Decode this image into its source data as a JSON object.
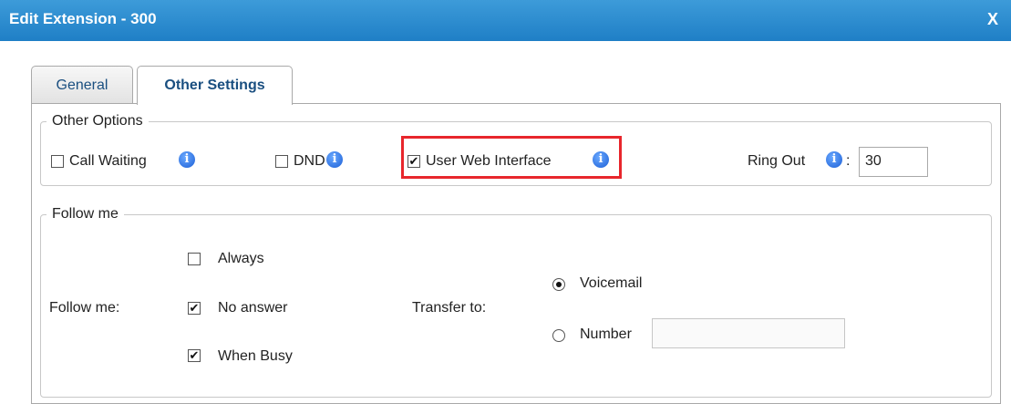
{
  "dialog": {
    "title": "Edit Extension - 300",
    "close_label": "X"
  },
  "tabs": [
    {
      "label": "General",
      "active": false
    },
    {
      "label": "Other Settings",
      "active": true
    }
  ],
  "other_options": {
    "legend": "Other Options",
    "call_waiting": {
      "label": "Call Waiting",
      "checked": false,
      "info_icon": "info-icon"
    },
    "dnd": {
      "label": "DND",
      "checked": false,
      "info_icon": "info-icon"
    },
    "user_web_interface": {
      "label": "User Web Interface",
      "checked": true,
      "info_icon": "info-icon",
      "highlight_color": "#e8262c"
    },
    "ring_out": {
      "label": "Ring Out",
      "separator": ":",
      "value": "30"
    }
  },
  "follow_me": {
    "legend": "Follow me",
    "label": "Follow me:",
    "always": {
      "label": "Always",
      "checked": false
    },
    "no_answer": {
      "label": "No answer",
      "checked": true
    },
    "when_busy": {
      "label": "When Busy",
      "checked": true
    },
    "transfer_label": "Transfer to:",
    "voicemail": {
      "label": "Voicemail",
      "selected": true
    },
    "number": {
      "label": "Number",
      "selected": false,
      "value": ""
    }
  },
  "colors": {
    "titlebar": "#2a8ad0",
    "tab_text": "#1a4f80",
    "info_icon": "#1c5fd6"
  }
}
